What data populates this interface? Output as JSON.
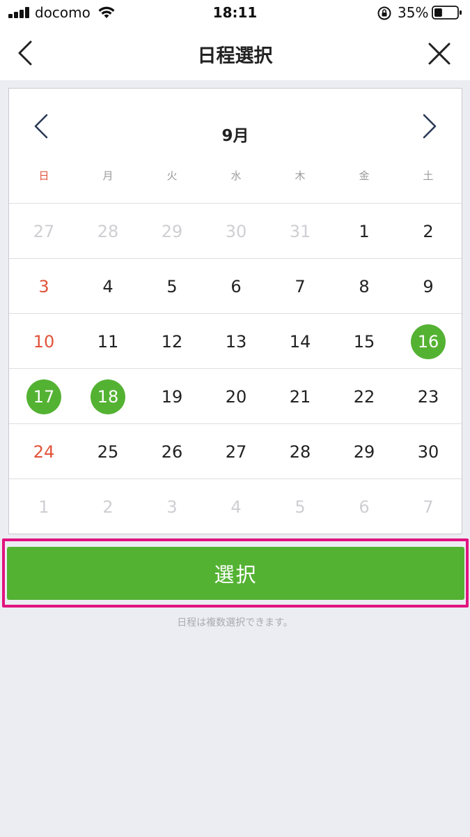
{
  "status_bar": {
    "carrier": "docomo",
    "time": "18:11",
    "battery_percent": "35%",
    "battery_level": 0.35,
    "icons": [
      "signal-icon",
      "wifi-icon",
      "rotation-lock-icon",
      "battery-icon"
    ]
  },
  "nav": {
    "title": "日程選択",
    "back_icon": "chevron-left-icon",
    "close_icon": "close-icon"
  },
  "calendar": {
    "month": "9月",
    "weekdays": [
      "日",
      "月",
      "火",
      "水",
      "木",
      "金",
      "土"
    ],
    "weeks": [
      [
        {
          "d": "27",
          "other": true
        },
        {
          "d": "28",
          "other": true
        },
        {
          "d": "29",
          "other": true
        },
        {
          "d": "30",
          "other": true
        },
        {
          "d": "31",
          "other": true
        },
        {
          "d": "1"
        },
        {
          "d": "2"
        }
      ],
      [
        {
          "d": "3"
        },
        {
          "d": "4"
        },
        {
          "d": "5"
        },
        {
          "d": "6"
        },
        {
          "d": "7"
        },
        {
          "d": "8"
        },
        {
          "d": "9"
        }
      ],
      [
        {
          "d": "10"
        },
        {
          "d": "11"
        },
        {
          "d": "12"
        },
        {
          "d": "13"
        },
        {
          "d": "14"
        },
        {
          "d": "15"
        },
        {
          "d": "16",
          "selected": true
        }
      ],
      [
        {
          "d": "17",
          "selected": true
        },
        {
          "d": "18",
          "selected": true
        },
        {
          "d": "19"
        },
        {
          "d": "20"
        },
        {
          "d": "21"
        },
        {
          "d": "22"
        },
        {
          "d": "23"
        }
      ],
      [
        {
          "d": "24"
        },
        {
          "d": "25"
        },
        {
          "d": "26"
        },
        {
          "d": "27"
        },
        {
          "d": "28"
        },
        {
          "d": "29"
        },
        {
          "d": "30"
        }
      ],
      [
        {
          "d": "1",
          "other": true
        },
        {
          "d": "2",
          "other": true
        },
        {
          "d": "3",
          "other": true
        },
        {
          "d": "4",
          "other": true
        },
        {
          "d": "5",
          "other": true
        },
        {
          "d": "6",
          "other": true
        },
        {
          "d": "7",
          "other": true
        }
      ]
    ]
  },
  "select_button": {
    "label": "選択"
  },
  "hint": "日程は複数選択できます。",
  "colors": {
    "accent_green": "#54b233",
    "sunday_red": "#e2533a",
    "highlight_magenta": "#e2137f",
    "background": "#ecedf2"
  }
}
